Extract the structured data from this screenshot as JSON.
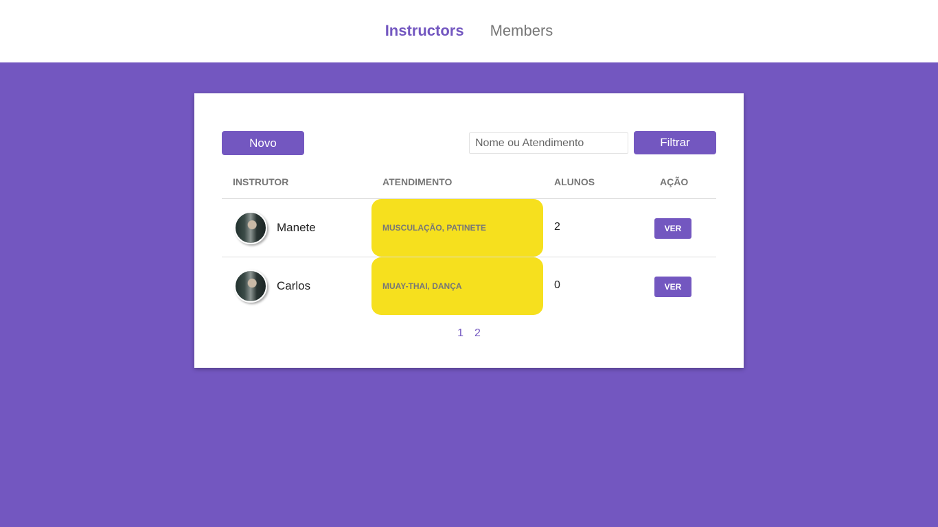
{
  "nav": {
    "items": [
      {
        "label": "Instructors",
        "active": true
      },
      {
        "label": "Members",
        "active": false
      }
    ]
  },
  "toolbar": {
    "new_label": "Novo",
    "search_placeholder": "Nome ou Atendimento",
    "search_value": "",
    "filter_label": "Filtrar"
  },
  "table": {
    "headers": [
      "INSTRUTOR",
      "ATENDIMENTO",
      "ALUNOS",
      "AÇÃO"
    ],
    "rows": [
      {
        "name": "Manete",
        "services": "MUSCULAÇÃO, PATINETE",
        "students": "2",
        "action": "VER"
      },
      {
        "name": "Carlos",
        "services": "MUAY-THAI, DANÇA",
        "students": "0",
        "action": "VER"
      }
    ]
  },
  "pagination": {
    "pages": [
      "1",
      "2"
    ]
  },
  "colors": {
    "accent": "#7357c0",
    "tag": "#f6e01e"
  }
}
